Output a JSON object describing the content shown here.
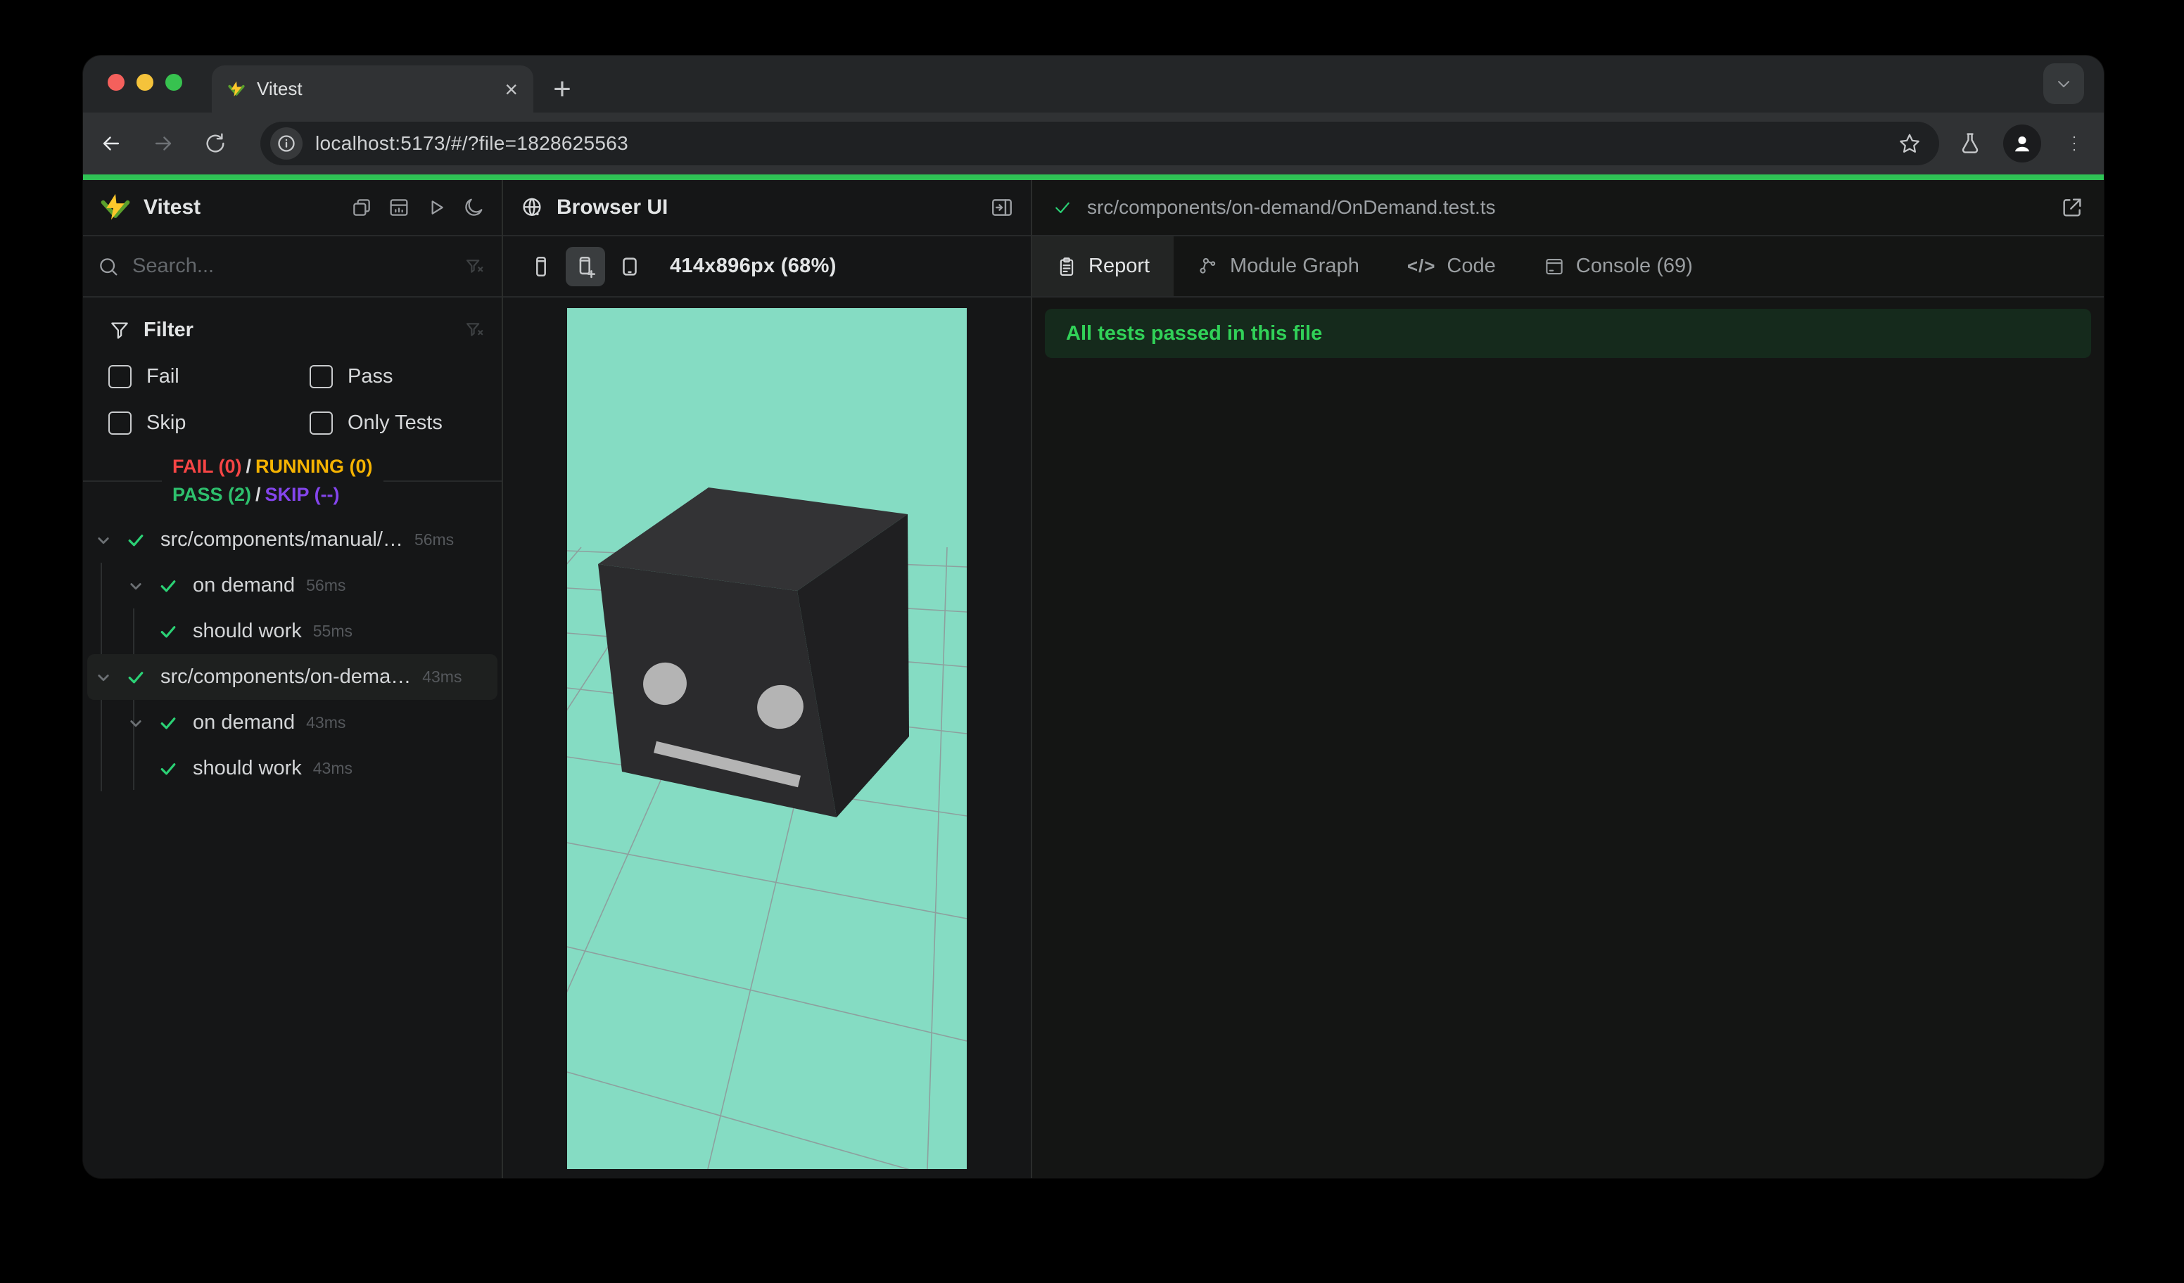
{
  "colors": {
    "accent": "#2fc355",
    "fail": "#f64545",
    "running": "#f5b301",
    "pass": "#2ec06d",
    "skip": "#8445ec",
    "check": "#2bd175",
    "teal": "#85dcc3",
    "banner_bg": "#152a1c",
    "banner_fg": "#31d158",
    "light_red": "#f4605c",
    "light_yellow": "#f5c33b",
    "light_green": "#37c24f"
  },
  "browser": {
    "tab_title": "Vitest",
    "url": "localhost:5173/#/?file=1828625563",
    "close_glyph": "×",
    "newtab_glyph": "+"
  },
  "sidebar": {
    "app_title": "Vitest",
    "search_placeholder": "Search...",
    "filter": {
      "title": "Filter",
      "options": [
        {
          "label": "Fail"
        },
        {
          "label": "Pass"
        },
        {
          "label": "Skip"
        },
        {
          "label": "Only Tests"
        }
      ]
    },
    "stats": {
      "fail": "FAIL (0)",
      "running": "RUNNING (0)",
      "pass": "PASS (2)",
      "skip": "SKIP (--)",
      "sep": "/"
    },
    "tree": [
      {
        "type": "file",
        "label": "src/components/manual/…",
        "time": "56ms",
        "selected": false
      },
      {
        "type": "suite",
        "label": "on demand",
        "time": "56ms",
        "selected": false
      },
      {
        "type": "test",
        "label": "should work",
        "time": "55ms",
        "selected": false
      },
      {
        "type": "file",
        "label": "src/components/on-dema…",
        "time": "43ms",
        "selected": true
      },
      {
        "type": "suite",
        "label": "on demand",
        "time": "43ms",
        "selected": false
      },
      {
        "type": "test",
        "label": "should work",
        "time": "43ms",
        "selected": false
      }
    ]
  },
  "browser_panel": {
    "title": "Browser UI",
    "viewport_label": "414x896px (68%)"
  },
  "report_panel": {
    "file_path": "src/components/on-demand/OnDemand.test.ts",
    "tabs": [
      {
        "label": "Report",
        "active": true
      },
      {
        "label": "Module Graph",
        "active": false
      },
      {
        "label": "Code",
        "active": false
      },
      {
        "label": "Console (69)",
        "active": false
      }
    ],
    "banner": "All tests passed in this file"
  }
}
